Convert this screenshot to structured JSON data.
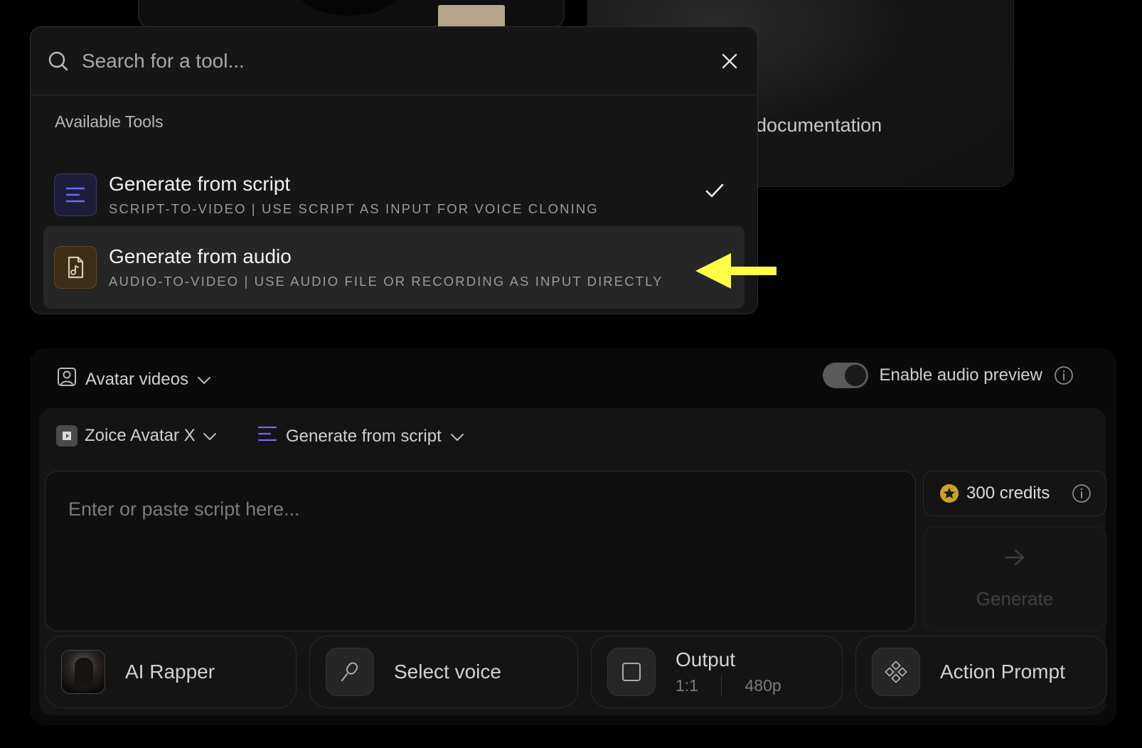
{
  "background": {
    "documentation_text": "documentation"
  },
  "tool_dropdown": {
    "search_placeholder": "Search for a tool...",
    "section_label": "Available Tools",
    "tools": [
      {
        "title": "Generate from script",
        "description": "SCRIPT-TO-VIDEO | USE SCRIPT AS INPUT FOR VOICE CLONING",
        "icon": "lines-icon",
        "selected": true
      },
      {
        "title": "Generate from audio",
        "description": "AUDIO-TO-VIDEO | USE AUDIO FILE OR RECORDING AS INPUT DIRECTLY",
        "icon": "audio-file-icon",
        "selected": false
      }
    ]
  },
  "annotation": {
    "arrow_color": "#ffff44"
  },
  "main_panel": {
    "mode_label": "Avatar videos",
    "audio_preview_label": "Enable audio preview",
    "audio_preview_enabled": true,
    "model_label": "Zoice Avatar X",
    "generation_mode_label": "Generate from script",
    "script_placeholder": "Enter or paste script here...",
    "credits_label": "300 credits",
    "generate_label": "Generate",
    "chips": {
      "avatar_label": "AI Rapper",
      "voice_label": "Select voice",
      "output_label": "Output",
      "output_ratio": "1:1",
      "output_resolution": "480p",
      "action_label": "Action Prompt"
    }
  },
  "colors": {
    "script_icon_accent": "#6c6cf0",
    "audio_icon_accent": "#d8c9a8",
    "star_accent": "#c9a227"
  }
}
